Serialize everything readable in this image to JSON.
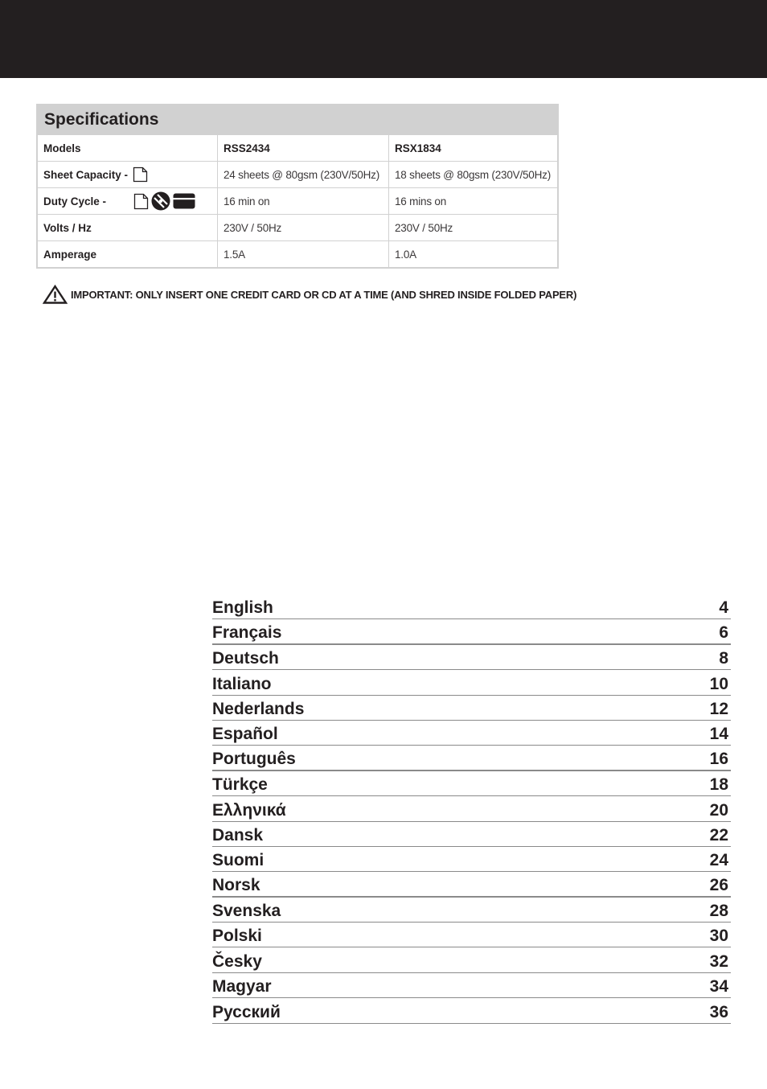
{
  "specifications": {
    "title": "Specifications",
    "header": {
      "label": "Models",
      "models": [
        "RSS2434",
        "RSX1834"
      ]
    },
    "rows": [
      {
        "label": "Sheet Capacity -",
        "icons": [
          "paper-sheet-icon"
        ],
        "values": [
          "24 sheets @ 80gsm (230V/50Hz)",
          "18 sheets @ 80gsm (230V/50Hz)"
        ]
      },
      {
        "label": "Duty Cycle -",
        "icons": [
          "paper-sheet-icon",
          "cd-icon",
          "credit-card-icon"
        ],
        "values": [
          "16 min on",
          "16 mins on"
        ]
      },
      {
        "label": "Volts / Hz",
        "icons": [],
        "values": [
          "230V / 50Hz",
          "230V / 50Hz"
        ]
      },
      {
        "label": "Amperage",
        "icons": [],
        "values": [
          "1.5A",
          "1.0A"
        ]
      }
    ]
  },
  "warning": {
    "icon": "warning-triangle-icon",
    "text": "IMPORTANT: ONLY INSERT ONE CREDIT CARD OR CD AT A TIME (AND SHRED INSIDE FOLDED PAPER)"
  },
  "contents": [
    {
      "language": "English",
      "page": "4"
    },
    {
      "language": "Français",
      "page": "6"
    },
    {
      "language": "Deutsch",
      "page": "8"
    },
    {
      "language": "Italiano",
      "page": "10"
    },
    {
      "language": "Nederlands",
      "page": "12"
    },
    {
      "language": "Español",
      "page": "14"
    },
    {
      "language": "Português",
      "page": "16"
    },
    {
      "language": "Türkçe",
      "page": "18"
    },
    {
      "language": "Ελληνικά",
      "page": "20"
    },
    {
      "language": "Dansk",
      "page": "22"
    },
    {
      "language": "Suomi",
      "page": "24"
    },
    {
      "language": "Norsk",
      "page": "26"
    },
    {
      "language": "Svenska",
      "page": "28"
    },
    {
      "language": "Polski",
      "page": "30"
    },
    {
      "language": "Česky",
      "page": "32"
    },
    {
      "language": "Magyar",
      "page": "34"
    },
    {
      "language": "Русский",
      "page": "36"
    }
  ]
}
